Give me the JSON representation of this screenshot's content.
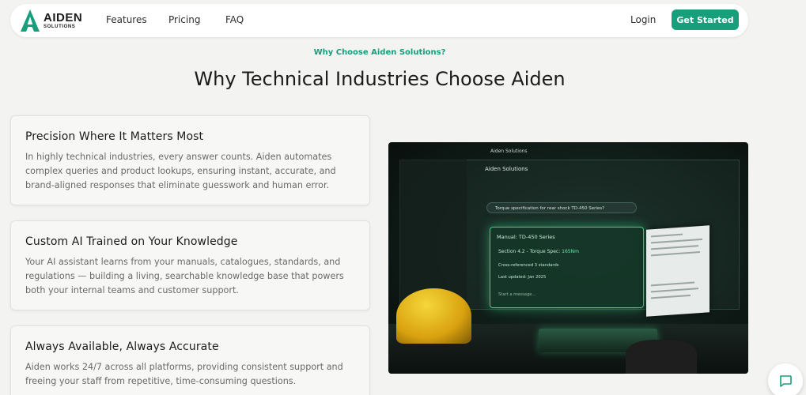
{
  "brand": {
    "name": "AIDEN",
    "tagline": "SOLUTIONS",
    "logo_icon": "aiden-a-logo-icon",
    "accent": "#179e7b"
  },
  "nav": {
    "links": [
      "Features",
      "Pricing",
      "FAQ"
    ],
    "login": "Login",
    "cta": "Get Started"
  },
  "section": {
    "eyebrow": "Why Choose Aiden Solutions?",
    "title": "Why Technical Industries Choose Aiden"
  },
  "cards": [
    {
      "title": "Precision Where It Matters Most",
      "body": "In highly technical industries, every answer counts. Aiden automates complex queries and product lookups, ensuring instant, accurate, and brand-aligned responses that eliminate guesswork and human error."
    },
    {
      "title": "Custom AI Trained on Your Knowledge",
      "body": "Your AI assistant learns from your manuals, catalogues, standards, and regulations — building a living, searchable knowledge base that powers both your internal teams and customer support."
    },
    {
      "title": "Always Available, Always Accurate",
      "body": "Aiden works 24/7 across all platforms, providing consistent support and freeing your staff from repetitive, time-consuming questions."
    }
  ],
  "hero": {
    "app_title": "Aiden Solutions",
    "panel_title": "Aiden Solutions",
    "search_text": "Torque specification for rear shock TD-450 Series?",
    "result_head": "Manual: TD-450 Series",
    "result_section": "Section 4.2 - Torque Spec:",
    "result_value": "165Nm",
    "result_ref": "Cross-referenced 3 standards",
    "result_updated": "Last updated: Jan 2025",
    "result_input": "Start a message..."
  },
  "chat": {
    "icon": "chat-bubble-icon"
  }
}
